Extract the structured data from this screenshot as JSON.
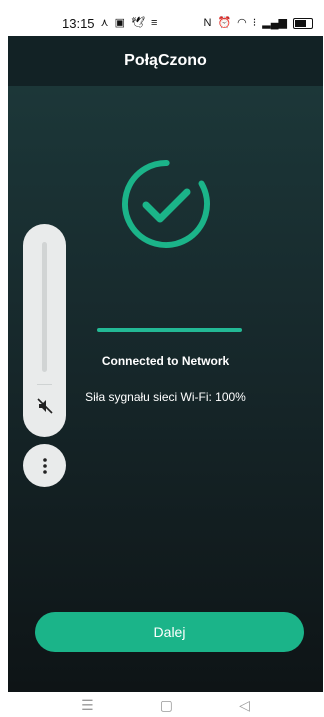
{
  "status_bar": {
    "time": "13:15",
    "left_icons": [
      "fork-icon",
      "message-icon",
      "twitter-icon",
      "signal-small-icon"
    ],
    "right_icons": [
      "nfc-icon",
      "alarm-icon",
      "wifi-icon",
      "network-4g-icon",
      "signal-bars-icon",
      "battery-icon"
    ]
  },
  "header": {
    "title": "PołąCzono"
  },
  "status": {
    "connected_text": "Connected to Network",
    "signal_text": "Siła sygnału sieci Wi-Fi: 100%",
    "progress": 1.0
  },
  "colors": {
    "accent": "#1bb489",
    "header_bg": "#122225"
  },
  "next_button": {
    "label": "Dalej"
  },
  "volume_panel": {
    "icons": [
      "speaker-mute-icon",
      "more-vertical-icon"
    ]
  },
  "nav_bar": {
    "icons": [
      "menu-icon",
      "home-square-icon",
      "back-triangle-icon"
    ]
  }
}
